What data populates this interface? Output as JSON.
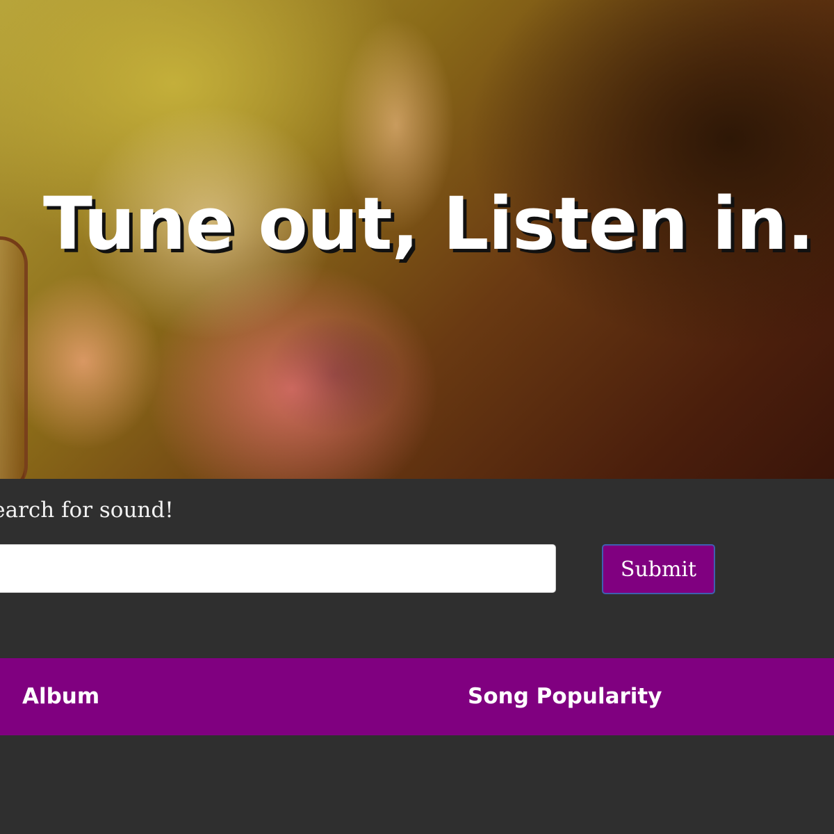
{
  "hero": {
    "headline": "Tune out, Listen in."
  },
  "search": {
    "prompt": "Search for sound!",
    "input_value": "",
    "input_placeholder": "",
    "submit_label": "Submit"
  },
  "results_table": {
    "headers": [
      "Album",
      "Song Popularity"
    ],
    "rows": []
  },
  "colors": {
    "page_background": "#2f2f2f",
    "accent_purple": "#800080",
    "button_border": "#3f5fb0",
    "text_light": "#ffffff"
  }
}
